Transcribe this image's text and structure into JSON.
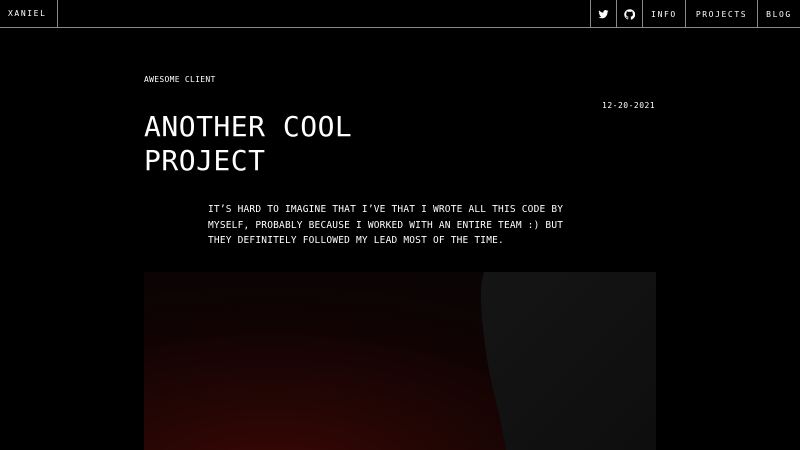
{
  "nav": {
    "brand": "XANIEL",
    "icons": [
      "twitter-icon",
      "github-icon"
    ],
    "links": {
      "info": "INFO",
      "projects": "PROJECTS",
      "blog": "BLOG"
    }
  },
  "project": {
    "client": "AWESOME CLIENT",
    "date": "12-20-2021",
    "title_line1": "ANOTHER COOL",
    "title_line2": "PROJECT",
    "description": "IT’S HARD TO IMAGINE THAT I’VE THAT I WROTE ALL THIS CODE BY MYSELF, PROBABLY BECAUSE I WORKED WITH AN ENTIRE TEAM :) BUT THEY DEFINITELY FOLLOWED MY LEAD MOST OF THE TIME."
  },
  "colors": {
    "background": "#000000",
    "text": "#ffffff",
    "divider": "#8a8a8a",
    "hero_red": "#3b0704",
    "hero_gray": "#141414"
  }
}
